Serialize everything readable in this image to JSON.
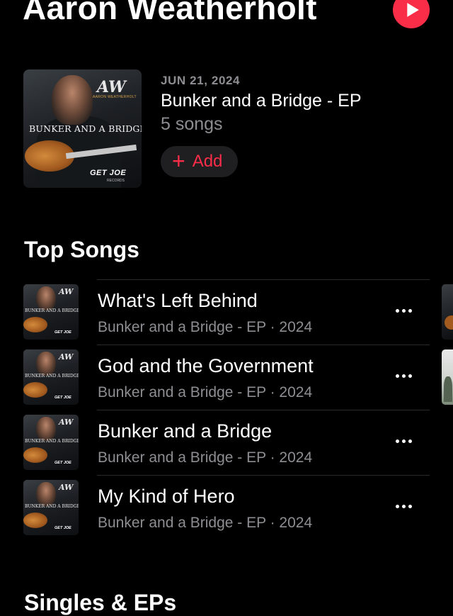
{
  "artist": {
    "name": "Aaron Weatherholt"
  },
  "latest_release": {
    "date": "JUN 21, 2024",
    "title": "Bunker and a Bridge - EP",
    "song_count": "5 songs",
    "add_label": "Add",
    "cover": {
      "logo": "AW",
      "logo_sub": "AARON WEATHERHOLT",
      "text": "BUNKER AND A BRIDGE",
      "label": "GET JOE",
      "label_sub": "RECORDS"
    }
  },
  "top_songs": {
    "title": "Top Songs",
    "items": [
      {
        "title": "What's Left Behind",
        "subtitle": "Bunker and a Bridge - EP · 2024"
      },
      {
        "title": "God and the Government",
        "subtitle": "Bunker and a Bridge - EP · 2024"
      },
      {
        "title": "Bunker and a Bridge",
        "subtitle": "Bunker and a Bridge - EP · 2024"
      },
      {
        "title": "My Kind of Hero",
        "subtitle": "Bunker and a Bridge - EP · 2024"
      }
    ]
  },
  "singles": {
    "title": "Singles & EPs"
  },
  "icons": {
    "play": "play-icon",
    "add": "plus-icon",
    "more": "ellipsis-icon"
  },
  "colors": {
    "accent": "#fa2d48",
    "background": "#000000",
    "secondary_text": "#8d8d92"
  }
}
